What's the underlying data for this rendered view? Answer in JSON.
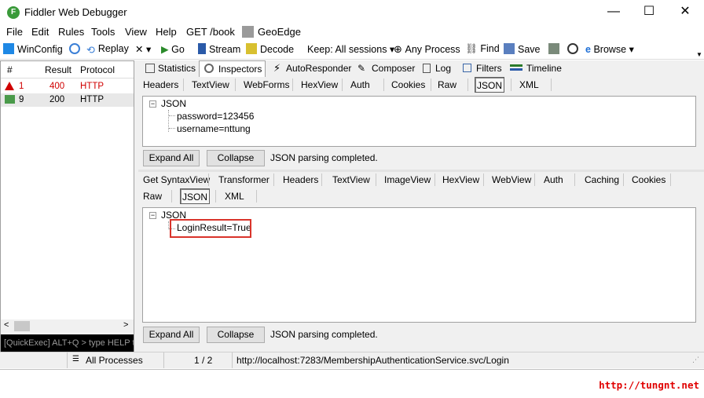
{
  "window": {
    "title": "Fiddler Web Debugger",
    "min": "—",
    "max": "☐",
    "close": "✕"
  },
  "menu": [
    "File",
    "Edit",
    "Rules",
    "Tools",
    "View",
    "Help",
    "GET /book",
    "GeoEdge"
  ],
  "toolbar": {
    "winconfig": "WinConfig",
    "replay": "Replay",
    "x": "✕ ▾",
    "go": "Go",
    "stream": "Stream",
    "decode": "Decode",
    "keep": "Keep: All sessions ▾",
    "anyprocess": "Any Process",
    "find": "Find",
    "save": "Save",
    "browse": "Browse ▾"
  },
  "sessions": {
    "headers": {
      "num": "#",
      "result": "Result",
      "protocol": "Protocol"
    },
    "rows": [
      {
        "num": "1",
        "result": "400",
        "protocol": "HTTP",
        "color": "#d00000"
      },
      {
        "num": "9",
        "result": "200",
        "protocol": "HTTP",
        "color": "#000000"
      }
    ],
    "quickexec": "[QuickExec] ALT+Q > type HELP to learn more"
  },
  "inspector_tabs": [
    "Statistics",
    "Inspectors",
    "AutoResponder",
    "Composer",
    "Log",
    "Filters",
    "Timeline"
  ],
  "request": {
    "tabs": [
      "Headers",
      "TextView",
      "WebForms",
      "HexView",
      "Auth",
      "Cookies",
      "Raw",
      "JSON",
      "XML"
    ],
    "root": "JSON",
    "items": [
      "password=123456",
      "username=nttung"
    ],
    "expand": "Expand All",
    "collapse": "Collapse",
    "status": "JSON parsing completed."
  },
  "response": {
    "tabs": [
      "Get SyntaxView",
      "Transformer",
      "Headers",
      "TextView",
      "ImageView",
      "HexView",
      "WebView",
      "Auth",
      "Caching",
      "Cookies"
    ],
    "tabs2": [
      "Raw",
      "JSON",
      "XML"
    ],
    "root": "JSON",
    "items": [
      "LoginResult=True"
    ],
    "expand": "Expand All",
    "collapse": "Collapse",
    "status": "JSON parsing completed."
  },
  "status": {
    "processes": "All Processes",
    "count": "1 / 2",
    "url": "http://localhost:7283/MembershipAuthenticationService.svc/Login"
  },
  "watermark": "http://tungnt.net",
  "highlight_color": "#d9342b"
}
